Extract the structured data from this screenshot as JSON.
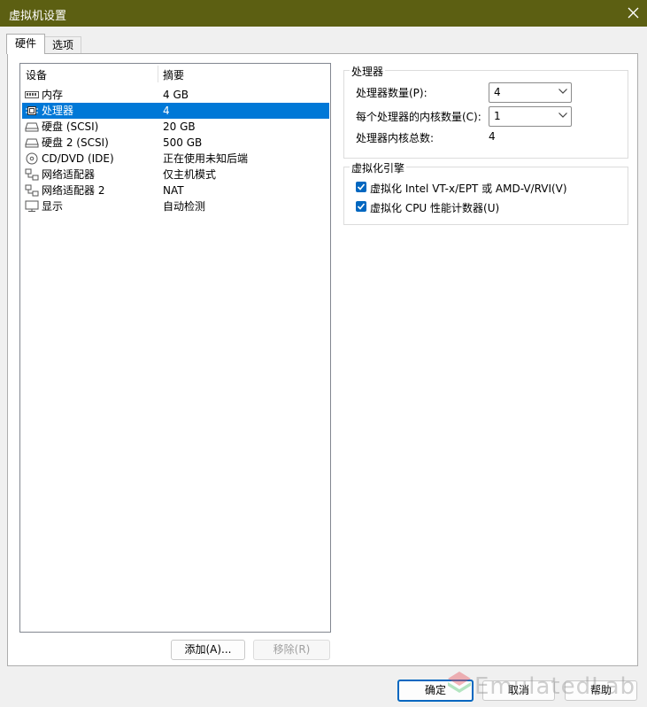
{
  "window": {
    "title": "虚拟机设置"
  },
  "tabs": [
    {
      "label": "硬件",
      "active": true
    },
    {
      "label": "选项",
      "active": false
    }
  ],
  "device_table": {
    "headers": [
      "设备",
      "摘要"
    ],
    "rows": [
      {
        "name": "内存",
        "summary": "4 GB",
        "icon": "memory-icon"
      },
      {
        "name": "处理器",
        "summary": "4",
        "icon": "processor-icon",
        "selected": true
      },
      {
        "name": "硬盘 (SCSI)",
        "summary": "20 GB",
        "icon": "hard-disk-icon"
      },
      {
        "name": "硬盘 2 (SCSI)",
        "summary": "500 GB",
        "icon": "hard-disk-icon"
      },
      {
        "name": "CD/DVD (IDE)",
        "summary": "正在使用未知后端",
        "icon": "cd-dvd-icon"
      },
      {
        "name": "网络适配器",
        "summary": "仅主机模式",
        "icon": "network-adapter-icon"
      },
      {
        "name": "网络适配器 2",
        "summary": "NAT",
        "icon": "network-adapter-icon"
      },
      {
        "name": "显示",
        "summary": "自动检测",
        "icon": "display-icon"
      }
    ]
  },
  "list_buttons": {
    "add": "添加(A)...",
    "remove": "移除(R)"
  },
  "processor": {
    "legend": "处理器",
    "count_label": "处理器数量(P):",
    "count_value": "4",
    "cores_label": "每个处理器的内核数量(C):",
    "cores_value": "1",
    "total_label": "处理器内核总数:",
    "total_value": "4"
  },
  "virtualization": {
    "legend": "虚拟化引擎",
    "vtx_label": "虚拟化 Intel VT-x/EPT 或 AMD-V/RVI(V)",
    "vtx_checked": true,
    "cpu_counter_label": "虚拟化 CPU 性能计数器(U)",
    "cpu_counter_checked": true
  },
  "dialog_buttons": {
    "ok": "确定",
    "cancel": "取消",
    "help": "帮助"
  },
  "watermark": "EmulatedLab",
  "colors": {
    "titlebar": "#5c5f12",
    "selection": "#0078d7",
    "accent": "#0067c0"
  }
}
